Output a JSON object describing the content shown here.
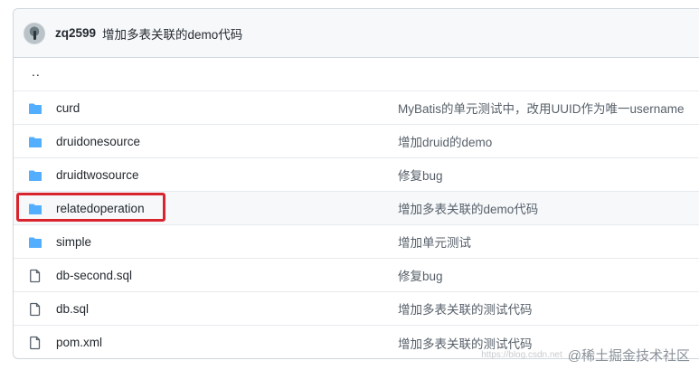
{
  "commit": {
    "author": "zq2599",
    "message": "增加多表关联的demo代码"
  },
  "parent_dir": "..",
  "files": [
    {
      "name": "curd",
      "type": "folder",
      "message": "MyBatis的单元测试中，改用UUID作为唯一username"
    },
    {
      "name": "druidonesource",
      "type": "folder",
      "message": "增加druid的demo"
    },
    {
      "name": "druidtwosource",
      "type": "folder",
      "message": "修复bug"
    },
    {
      "name": "relatedoperation",
      "type": "folder",
      "message": "增加多表关联的demo代码"
    },
    {
      "name": "simple",
      "type": "folder",
      "message": "增加单元测试"
    },
    {
      "name": "db-second.sql",
      "type": "file",
      "message": "修复bug"
    },
    {
      "name": "db.sql",
      "type": "file",
      "message": "增加多表关联的测试代码"
    },
    {
      "name": "pom.xml",
      "type": "file",
      "message": "增加多表关联的测试代码"
    }
  ],
  "colors": {
    "folder": "#54aeff",
    "file_outline": "#57606a",
    "highlight_border": "#d9232d"
  },
  "watermark": {
    "main": "@稀土掘金技术社区",
    "url": "https://blog.csdn.net"
  }
}
